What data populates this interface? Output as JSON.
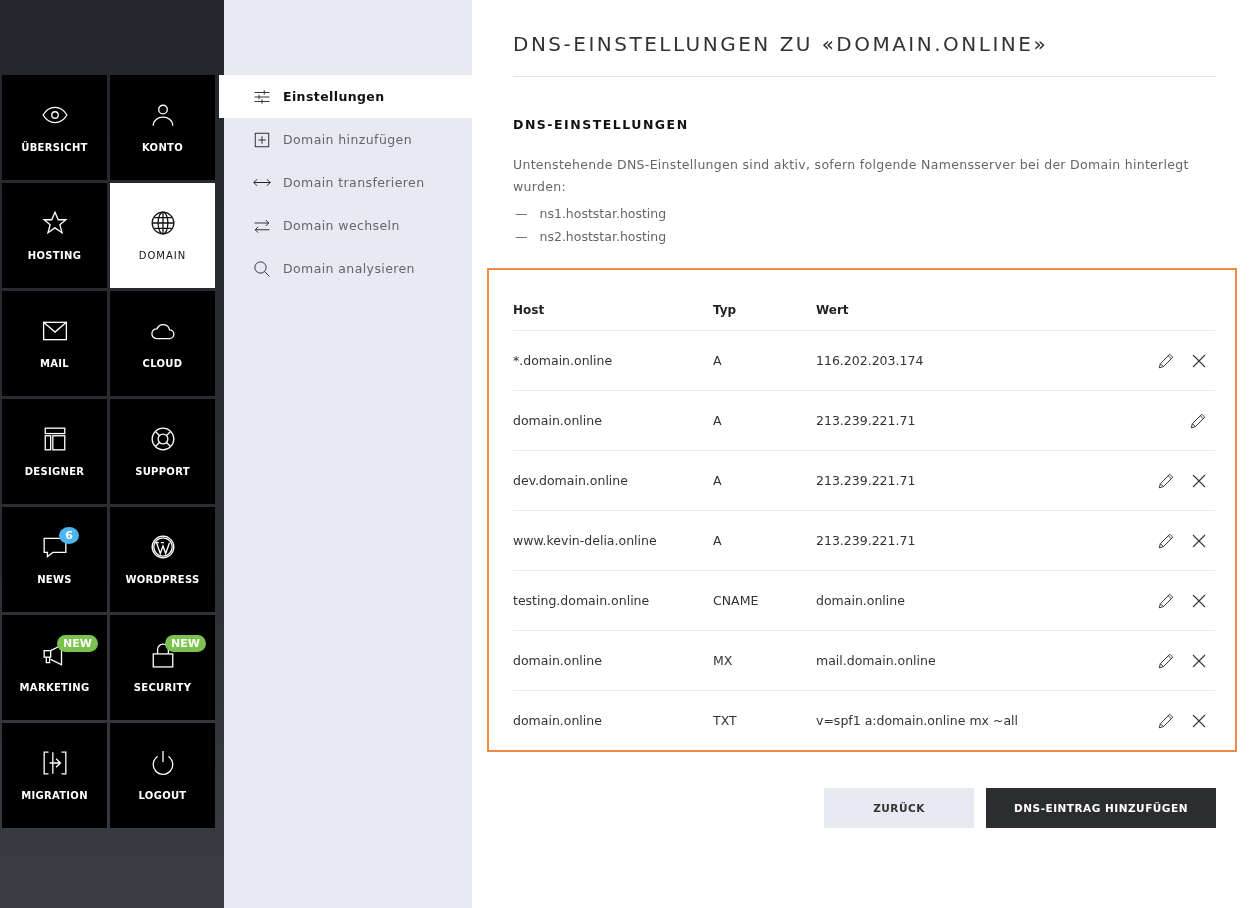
{
  "tiles": [
    {
      "label": "ÜBERSICHT",
      "selected": false
    },
    {
      "label": "KONTO",
      "selected": false
    },
    {
      "label": "HOSTING",
      "selected": false
    },
    {
      "label": "DOMAIN",
      "selected": true
    },
    {
      "label": "MAIL",
      "selected": false
    },
    {
      "label": "CLOUD",
      "selected": false
    },
    {
      "label": "DESIGNER",
      "selected": false
    },
    {
      "label": "SUPPORT",
      "selected": false
    },
    {
      "label": "NEWS",
      "selected": false,
      "badge": {
        "text": "6",
        "color": "#4db6f0"
      }
    },
    {
      "label": "WORDPRESS",
      "selected": false
    },
    {
      "label": "MARKETING",
      "selected": false,
      "badge": {
        "text": "NEW",
        "color": "#7cc24e"
      }
    },
    {
      "label": "SECURITY",
      "selected": false,
      "badge": {
        "text": "NEW",
        "color": "#7cc24e"
      }
    },
    {
      "label": "MIGRATION",
      "selected": false
    },
    {
      "label": "LOGOUT",
      "selected": false
    }
  ],
  "subnav": [
    {
      "label": "Einstellungen",
      "selected": true
    },
    {
      "label": "Domain hinzufügen",
      "selected": false
    },
    {
      "label": "Domain transferieren",
      "selected": false
    },
    {
      "label": "Domain wechseln",
      "selected": false
    },
    {
      "label": "Domain analysieren",
      "selected": false
    }
  ],
  "title": "DNS-EINSTELLUNGEN ZU «DOMAIN.ONLINE»",
  "section_title": "DNS-EINSTELLUNGEN",
  "description": "Untenstehende DNS-Einstellungen sind aktiv, sofern folgende Namensserver bei der Domain hinterlegt wurden:",
  "nameservers": [
    {
      "dash": "—",
      "name": "ns1.hoststar.hosting"
    },
    {
      "dash": "—",
      "name": "ns2.hoststar.hosting"
    }
  ],
  "table": {
    "columns": [
      "Host",
      "Typ",
      "Wert"
    ],
    "rows": [
      {
        "host": "*.domain.online",
        "type": "A",
        "value": "116.202.203.174",
        "deletable": true
      },
      {
        "host": "domain.online",
        "type": "A",
        "value": "213.239.221.71",
        "deletable": false
      },
      {
        "host": "dev.domain.online",
        "type": "A",
        "value": "213.239.221.71",
        "deletable": true
      },
      {
        "host": "www.kevin-delia.online",
        "type": "A",
        "value": "213.239.221.71",
        "deletable": true
      },
      {
        "host": "testing.domain.online",
        "type": "CNAME",
        "value": "domain.online",
        "deletable": true
      },
      {
        "host": "domain.online",
        "type": "MX",
        "value": "mail.domain.online",
        "deletable": true
      },
      {
        "host": "domain.online",
        "type": "TXT",
        "value": "v=spf1 a:domain.online mx ~all",
        "deletable": true
      }
    ]
  },
  "buttons": [
    {
      "label": "ZURÜCK",
      "kind": "secondary"
    },
    {
      "label": "DNS-EINTRAG HINZUFÜGEN",
      "kind": "primary"
    }
  ]
}
